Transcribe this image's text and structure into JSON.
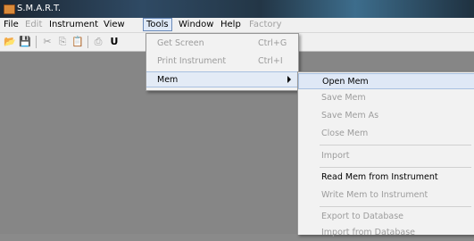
{
  "window": {
    "title": "S.M.A.R.T."
  },
  "menubar": {
    "items": [
      {
        "label": "File",
        "state": "normal"
      },
      {
        "label": "Edit",
        "state": "disabled"
      },
      {
        "label": "Instrument",
        "state": "normal"
      },
      {
        "label": "View",
        "state": "normal"
      },
      {
        "label": "Tools",
        "state": "active"
      },
      {
        "label": "Window",
        "state": "normal"
      },
      {
        "label": "Help",
        "state": "normal"
      },
      {
        "label": "Factory",
        "state": "disabled"
      }
    ]
  },
  "toolbar": {
    "buttons": [
      {
        "icon": "open-folder-icon",
        "glyph": "📂"
      },
      {
        "icon": "save-icon",
        "glyph": "💾"
      },
      {
        "icon": "cut-icon",
        "glyph": "✂"
      },
      {
        "icon": "copy-icon",
        "glyph": "⎘"
      },
      {
        "icon": "paste-icon",
        "glyph": "📋"
      },
      {
        "icon": "print-icon",
        "glyph": "⎙"
      },
      {
        "icon": "u-icon",
        "glyph": "U"
      }
    ]
  },
  "tools_menu": {
    "items": [
      {
        "label": "Get Screen",
        "shortcut": "Ctrl+G",
        "disabled": true
      },
      {
        "label": "Print Instrument",
        "shortcut": "Ctrl+I",
        "disabled": true
      },
      {
        "label": "Mem",
        "shortcut": "",
        "disabled": false,
        "submenu": true
      }
    ]
  },
  "mem_submenu": {
    "items": [
      {
        "label": "Open Mem",
        "disabled": false,
        "highlight": true
      },
      {
        "label": "Save Mem",
        "disabled": true
      },
      {
        "label": "Save Mem As",
        "disabled": true
      },
      {
        "label": "Close Mem",
        "disabled": true
      },
      {
        "label": "Import",
        "disabled": true
      },
      {
        "label": "Read Mem from Instrument",
        "disabled": false
      },
      {
        "label": "Write Mem  to Instrument",
        "disabled": true
      },
      {
        "label": "Export to Database",
        "disabled": true
      },
      {
        "label": "Import from Database",
        "disabled": true
      }
    ]
  }
}
